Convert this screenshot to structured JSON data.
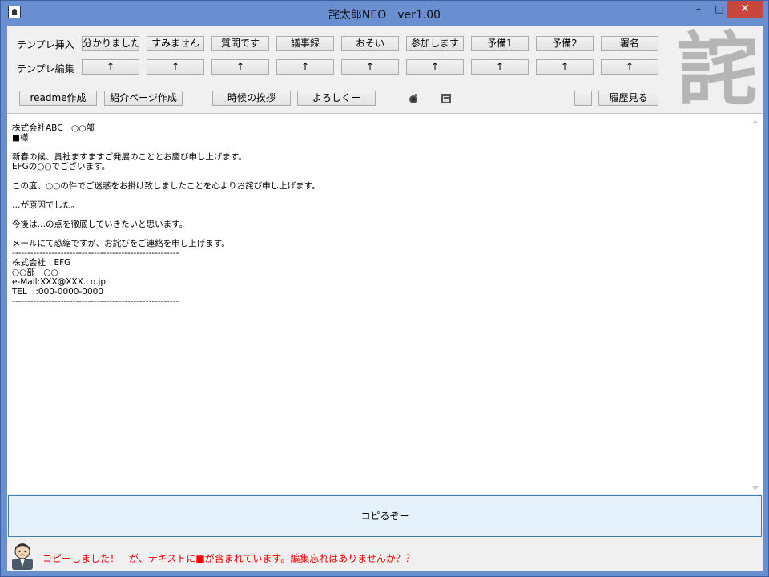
{
  "window": {
    "title": "詫太郎NEO　ver1.00",
    "minimize": "–",
    "maximize": "□",
    "close": "✕"
  },
  "toolbar": {
    "insert_label": "テンプレ挿入",
    "edit_label": "テンプレ編集",
    "templates": [
      "分かりました",
      "すみません",
      "質問です",
      "議事録",
      "おそい",
      "参加します",
      "予備1",
      "予備2",
      "署名"
    ],
    "edit_arrow": "↑",
    "readme": "readme作成",
    "intro_page": "紹介ページ作成",
    "seasonal": "時候の挨拶",
    "yoroshiku": "よろしくー",
    "history": "履歴見る",
    "logo_char": "詫"
  },
  "editor": {
    "text": "株式会社ABC　○○部\n■様\n\n新春の候、貴社ますますご発展のこととお慶び申し上げます。\nEFGの○○でございます。\n\nこの度、○○の件でご迷惑をお掛け致しましたことを心よりお詫び申し上げます。\n\n…が原因でした。\n\n今後は…の点を徹底していきたいと思います。\n\nメールにて恐縮ですが、お詫びをご連絡を申し上げます。\n-------------------------------------------------------\n株式会社　EFG\n○○部　○○\ne-Mail:XXX@XXX.co.jp\nTEL　:000-0000-0000\n-------------------------------------------------------"
  },
  "copy_button": "コピるぞー",
  "status": {
    "before": "コピーしました！　が、テキストに",
    "square": "■",
    "after": "が含まれています。編集忘れはありませんか？？"
  },
  "colors": {
    "titlebar": "#6a8fd0",
    "close": "#c7473c",
    "status_text": "#ff0000"
  }
}
